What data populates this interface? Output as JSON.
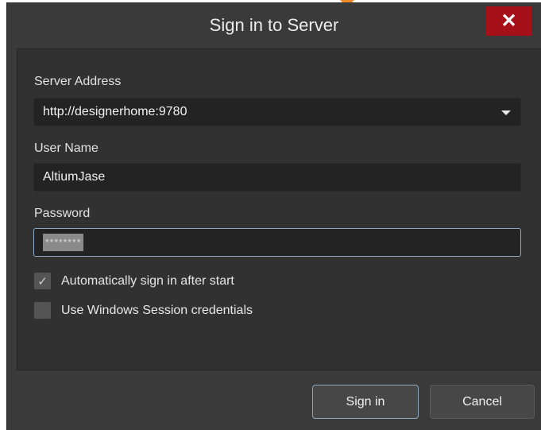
{
  "window": {
    "title": "Sign in to Server"
  },
  "fields": {
    "server_address": {
      "label": "Server Address",
      "value": "http://designerhome:9780"
    },
    "user_name": {
      "label": "User Name",
      "value": "AltiumJase"
    },
    "password": {
      "label": "Password",
      "value": "********"
    }
  },
  "options": {
    "auto_sign_in": {
      "label": "Automatically sign in after start",
      "checked": true
    },
    "windows_session": {
      "label": "Use Windows Session credentials",
      "checked": false
    }
  },
  "buttons": {
    "sign_in": "Sign in",
    "cancel": "Cancel"
  },
  "icons": {
    "close": "close-icon",
    "dropdown": "chevron-down-icon",
    "check": "checkmark-icon"
  },
  "colors": {
    "close_bg": "#a61018",
    "focus_border": "#8da8c0",
    "accent": "#f08a24"
  }
}
